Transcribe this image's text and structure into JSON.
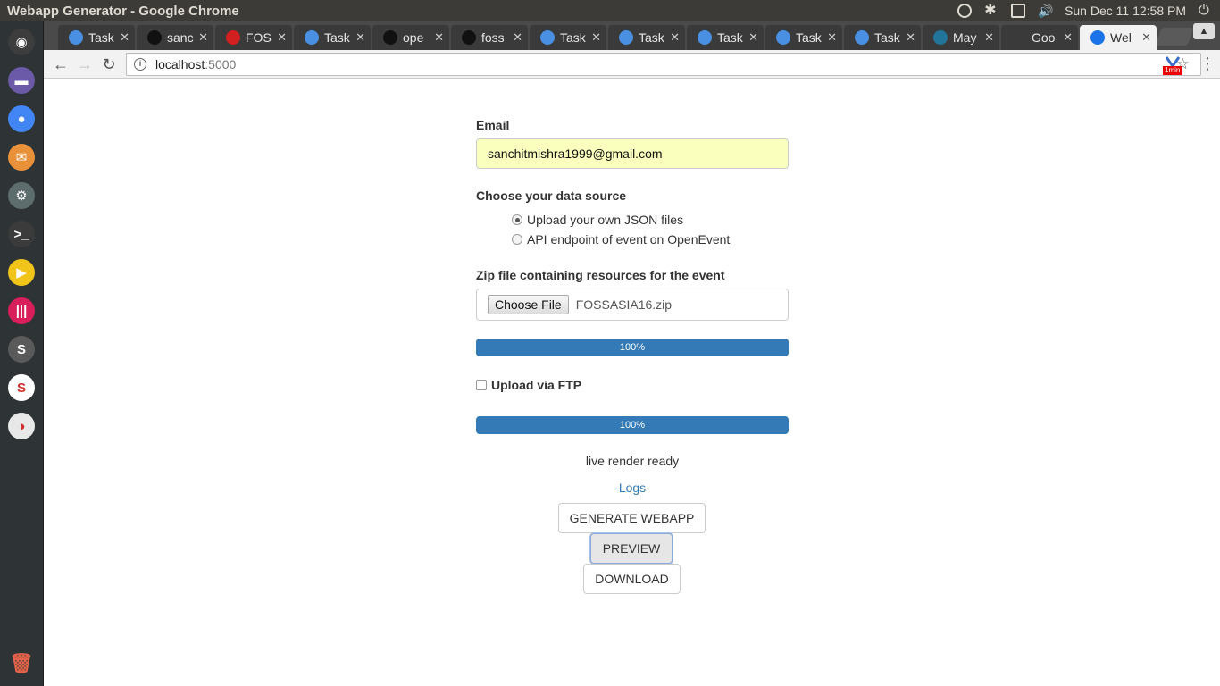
{
  "system": {
    "window_title": "Webapp Generator - Google Chrome",
    "clock": "Sun Dec 11 12:58 PM"
  },
  "launcher": {
    "items": [
      {
        "name": "ubuntu-logo-icon",
        "color": "#3d3d3d",
        "glyph": "◉"
      },
      {
        "name": "files-icon",
        "color": "#6a5aa8",
        "glyph": "▬"
      },
      {
        "name": "chrome-icon",
        "color": "#4285f4",
        "glyph": "●"
      },
      {
        "name": "software-center-icon",
        "color": "#e8913a",
        "glyph": "✉"
      },
      {
        "name": "settings-toggle-icon",
        "color": "#5d6d6d",
        "glyph": "⚙"
      },
      {
        "name": "terminal-icon",
        "color": "#3b3b3b",
        "glyph": ">_"
      },
      {
        "name": "media-player-icon",
        "color": "#f0c419",
        "glyph": "▶"
      },
      {
        "name": "gitkraken-icon",
        "color": "#d81e5b",
        "glyph": "|||"
      },
      {
        "name": "sublime-text-icon",
        "color": "#5a5a5a",
        "glyph": "S"
      },
      {
        "name": "slack-icon",
        "color": "#ffffff",
        "glyph": "S"
      },
      {
        "name": "timer-icon",
        "color": "#e8e8e8",
        "glyph": "◑"
      }
    ],
    "trash": "trash-icon"
  },
  "tabs": [
    {
      "title": "Task",
      "color": "#4a90e2"
    },
    {
      "title": "sanc",
      "color": "#111111"
    },
    {
      "title": "FOS",
      "color": "#d21f1f"
    },
    {
      "title": "Task",
      "color": "#4a90e2"
    },
    {
      "title": "ope",
      "color": "#111111"
    },
    {
      "title": "foss",
      "color": "#111111"
    },
    {
      "title": "Task",
      "color": "#4a90e2"
    },
    {
      "title": "Task",
      "color": "#4a90e2"
    },
    {
      "title": "Task",
      "color": "#4a90e2"
    },
    {
      "title": "Task",
      "color": "#4a90e2"
    },
    {
      "title": "Task",
      "color": "#4a90e2"
    },
    {
      "title": "May",
      "color": "#21759b"
    },
    {
      "title": "Goo",
      "color": "#3a3a3a"
    },
    {
      "title": "Wel",
      "color": "#1a73e8",
      "active": true
    }
  ],
  "address": {
    "host": "localhost",
    "port": ":5000"
  },
  "extension": {
    "badge": "1min"
  },
  "form": {
    "email_label": "Email",
    "email_value": "sanchitmishra1999@gmail.com",
    "datasource_label": "Choose your data source",
    "radio_options": [
      "Upload your own JSON files",
      "API endpoint of event on OpenEvent"
    ],
    "radio_selected": 0,
    "zip_label": "Zip file containing resources for the event",
    "choose_file": "Choose File",
    "file_name": "FOSSASIA16.zip",
    "progress1": {
      "label": "100%",
      "value": 100
    },
    "ftp_label": "Upload via FTP",
    "progress2": {
      "label": "100%",
      "value": 100
    },
    "status": "live render ready",
    "logs": "-Logs-",
    "generate_btn": "GENERATE WEBAPP",
    "preview_btn": "PREVIEW",
    "download_btn": "DOWNLOAD"
  },
  "colors": {
    "progress": "#337ab7",
    "link": "#337ab7",
    "autofill": "#faffbd"
  }
}
